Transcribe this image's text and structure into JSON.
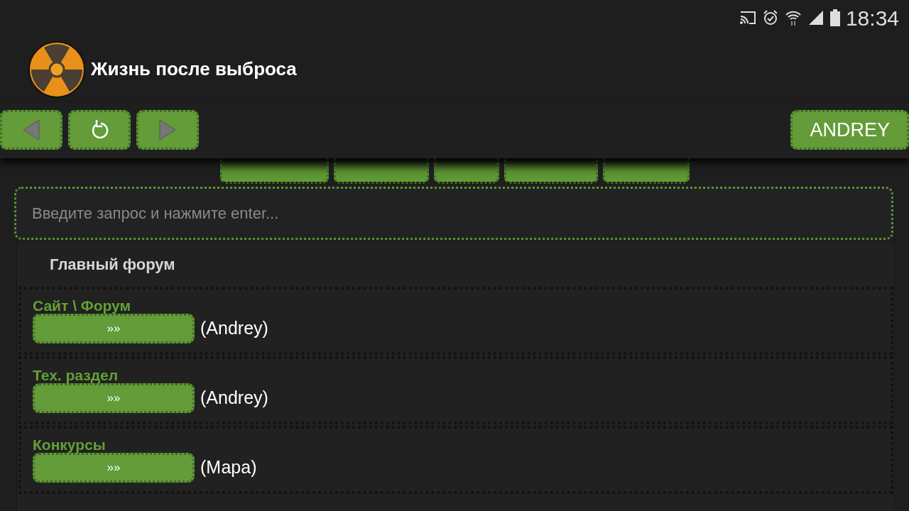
{
  "status_bar": {
    "time": "18:34"
  },
  "app_bar": {
    "title": "Жизнь после выброса"
  },
  "toolbar": {
    "buttons": [
      {
        "kind": "back"
      },
      {
        "kind": "refresh"
      },
      {
        "kind": "forward"
      }
    ],
    "user_button": "ANDREY"
  },
  "search": {
    "placeholder": "Введите запрос и нажмите enter..."
  },
  "section": {
    "title": "Главный форум",
    "forums": [
      {
        "title": "Сайт \\ Форум",
        "button": "»»",
        "author": "(Andrey)"
      },
      {
        "title": "Тех. раздел",
        "button": "»»",
        "author": "(Andrey)"
      },
      {
        "title": "Конкурсы",
        "button": "»»",
        "author": "(Мара)"
      }
    ]
  }
}
